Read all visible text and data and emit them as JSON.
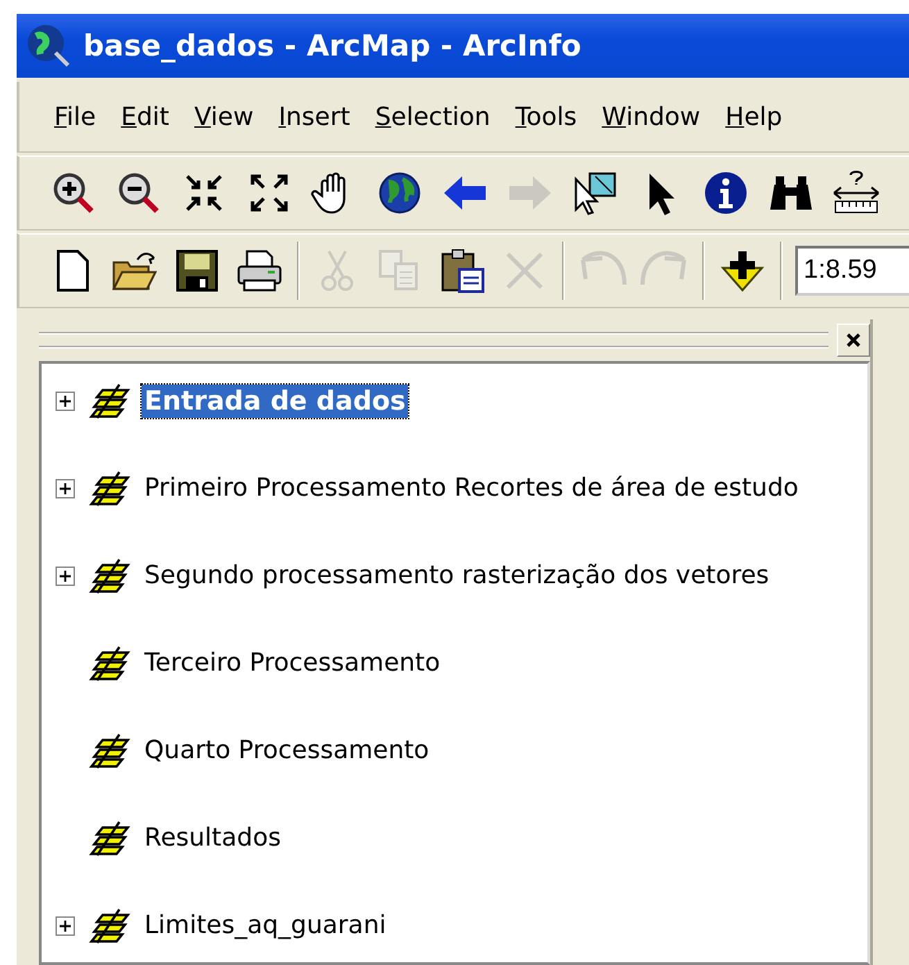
{
  "window": {
    "title": "base_dados - ArcMap - ArcInfo"
  },
  "menu": [
    {
      "label": "File",
      "first_letter_underlined": true
    },
    {
      "label": "Edit",
      "first_letter_underlined": true
    },
    {
      "label": "View",
      "first_letter_underlined": true
    },
    {
      "label": "Insert",
      "first_letter_underlined": true
    },
    {
      "label": "Selection",
      "first_letter_underlined": true
    },
    {
      "label": "Tools",
      "first_letter_underlined": true
    },
    {
      "label": "Window",
      "first_letter_underlined": true
    },
    {
      "label": "Help",
      "first_letter_underlined": true
    }
  ],
  "toolbars": [
    {
      "items": [
        {
          "kind": "zoom-in",
          "disabled": false
        },
        {
          "kind": "zoom-out",
          "disabled": false
        },
        {
          "kind": "fixed-zoom-in",
          "disabled": false
        },
        {
          "kind": "fixed-zoom-out",
          "disabled": false
        },
        {
          "kind": "pan",
          "disabled": false
        },
        {
          "kind": "globe",
          "disabled": false
        },
        {
          "kind": "back",
          "disabled": false
        },
        {
          "kind": "forward",
          "disabled": true
        },
        {
          "kind": "select-features",
          "disabled": false
        },
        {
          "kind": "pointer",
          "disabled": false
        },
        {
          "kind": "info",
          "disabled": false
        },
        {
          "kind": "find",
          "disabled": false
        },
        {
          "kind": "measure",
          "disabled": false
        }
      ]
    },
    {
      "items": [
        {
          "kind": "new",
          "disabled": false
        },
        {
          "kind": "open",
          "disabled": false
        },
        {
          "kind": "save",
          "disabled": false
        },
        {
          "kind": "print",
          "disabled": false
        },
        {
          "kind": "sep"
        },
        {
          "kind": "cut",
          "disabled": true
        },
        {
          "kind": "copy",
          "disabled": true
        },
        {
          "kind": "paste",
          "disabled": false
        },
        {
          "kind": "delete",
          "disabled": true
        },
        {
          "kind": "sep"
        },
        {
          "kind": "undo",
          "disabled": true
        },
        {
          "kind": "redo",
          "disabled": true
        },
        {
          "kind": "sep"
        },
        {
          "kind": "add-data",
          "disabled": false
        },
        {
          "kind": "sep"
        },
        {
          "kind": "scale",
          "value": "1:8.59"
        }
      ]
    }
  ],
  "toc": {
    "layers": [
      {
        "label": "Entrada de dados",
        "expandable": true,
        "selected": true
      },
      {
        "label": "Primeiro Processamento Recortes de área de estudo",
        "expandable": true,
        "selected": false
      },
      {
        "label": "Segundo processamento rasterização dos vetores",
        "expandable": true,
        "selected": false
      },
      {
        "label": "Terceiro Processamento",
        "expandable": false,
        "selected": false
      },
      {
        "label": "Quarto Processamento",
        "expandable": false,
        "selected": false
      },
      {
        "label": "Resultados",
        "expandable": false,
        "selected": false
      },
      {
        "label": "Limites_aq_guarani",
        "expandable": true,
        "selected": false
      }
    ]
  }
}
